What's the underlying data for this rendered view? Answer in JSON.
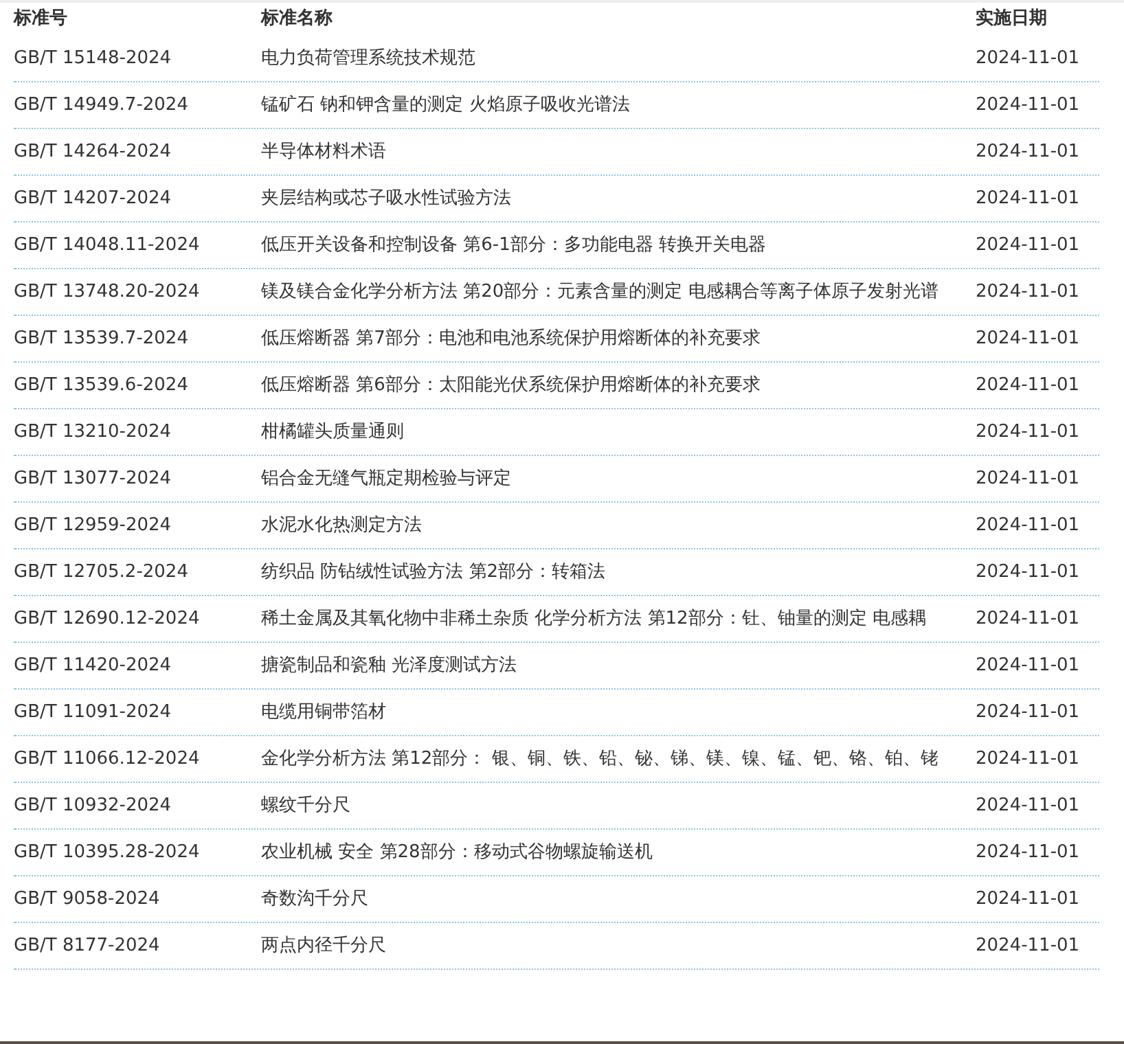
{
  "table": {
    "columns": [
      "标准号",
      "标准名称",
      "实施日期"
    ],
    "rows": [
      {
        "code": "GB/T 15148-2024",
        "name": "电力负荷管理系统技术规范",
        "date": "2024-11-01"
      },
      {
        "code": "GB/T 14949.7-2024",
        "name": "锰矿石 钠和钾含量的测定 火焰原子吸收光谱法",
        "date": "2024-11-01"
      },
      {
        "code": "GB/T 14264-2024",
        "name": "半导体材料术语",
        "date": "2024-11-01"
      },
      {
        "code": "GB/T 14207-2024",
        "name": "夹层结构或芯子吸水性试验方法",
        "date": "2024-11-01"
      },
      {
        "code": "GB/T 14048.11-2024",
        "name": "低压开关设备和控制设备 第6-1部分：多功能电器 转换开关电器",
        "date": "2024-11-01"
      },
      {
        "code": "GB/T 13748.20-2024",
        "name": "镁及镁合金化学分析方法 第20部分：元素含量的测定 电感耦合等离子体原子发射光谱",
        "date": "2024-11-01"
      },
      {
        "code": "GB/T 13539.7-2024",
        "name": "低压熔断器 第7部分：电池和电池系统保护用熔断体的补充要求",
        "date": "2024-11-01"
      },
      {
        "code": "GB/T 13539.6-2024",
        "name": "低压熔断器 第6部分：太阳能光伏系统保护用熔断体的补充要求",
        "date": "2024-11-01"
      },
      {
        "code": "GB/T 13210-2024",
        "name": "柑橘罐头质量通则",
        "date": "2024-11-01"
      },
      {
        "code": "GB/T 13077-2024",
        "name": "铝合金无缝气瓶定期检验与评定",
        "date": "2024-11-01"
      },
      {
        "code": "GB/T 12959-2024",
        "name": "水泥水化热测定方法",
        "date": "2024-11-01"
      },
      {
        "code": "GB/T 12705.2-2024",
        "name": "纺织品 防钻绒性试验方法 第2部分：转箱法",
        "date": "2024-11-01"
      },
      {
        "code": "GB/T 12690.12-2024",
        "name": "稀土金属及其氧化物中非稀土杂质 化学分析方法 第12部分：钍、铀量的测定 电感耦",
        "date": "2024-11-01"
      },
      {
        "code": "GB/T 11420-2024",
        "name": "搪瓷制品和瓷釉 光泽度测试方法",
        "date": "2024-11-01"
      },
      {
        "code": "GB/T 11091-2024",
        "name": "电缆用铜带箔材",
        "date": "2024-11-01"
      },
      {
        "code": "GB/T 11066.12-2024",
        "name": "金化学分析方法 第12部分： 银、铜、铁、铅、铋、锑、镁、镍、锰、钯、铬、铂、铑",
        "date": "2024-11-01"
      },
      {
        "code": "GB/T 10932-2024",
        "name": "螺纹千分尺",
        "date": "2024-11-01"
      },
      {
        "code": "GB/T 10395.28-2024",
        "name": "农业机械 安全 第28部分：移动式谷物螺旋输送机",
        "date": "2024-11-01"
      },
      {
        "code": "GB/T 9058-2024",
        "name": "奇数沟千分尺",
        "date": "2024-11-01"
      },
      {
        "code": "GB/T 8177-2024",
        "name": "两点内径千分尺",
        "date": "2024-11-01"
      }
    ]
  }
}
